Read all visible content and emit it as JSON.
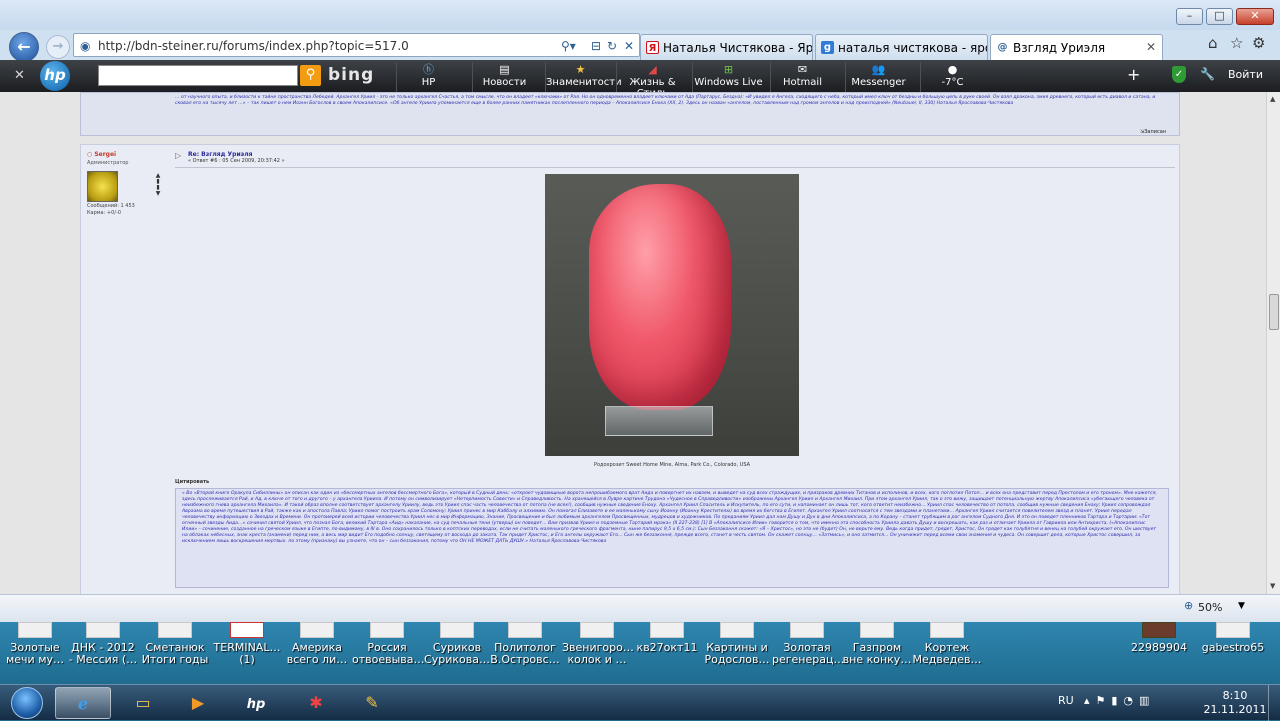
{
  "browser": {
    "url": "http://bdn-steiner.ru/forums/index.php?topic=517.0",
    "tabs": [
      {
        "label": "Наталья Чистякова - Ярос…",
        "icon": "Я"
      },
      {
        "label": "наталья чистякова - яросл…",
        "icon": "g"
      },
      {
        "label": "Взгляд Уриэля",
        "icon": "@"
      }
    ],
    "zoom": "50%",
    "window_buttons": {
      "minimize": "–",
      "maximize": "□",
      "close": "✕"
    }
  },
  "hp_toolbar": {
    "bing": "bing",
    "items": [
      {
        "label": "HP",
        "icon": "hp"
      },
      {
        "label": "Новости",
        "icon": "news"
      },
      {
        "label": "Знаменитости",
        "icon": "star"
      },
      {
        "label": "Жизнь & Стиль",
        "icon": "shoe"
      },
      {
        "label": "Windows Live",
        "icon": "windows"
      },
      {
        "label": "Hotmail",
        "icon": "mail"
      },
      {
        "label": "Messenger",
        "icon": "people"
      },
      {
        "label": "-7°C",
        "icon": "weather"
      }
    ],
    "login": "Войти"
  },
  "forum": {
    "prev_post_text": "… от научного опыта, и близости к тайне пространства Лебедей. Архангел Уриил - это не только архангел Счастья, а том смысле, что он владеет «ключами» от Рая. Но он одновременно владеет ключами от Ада (Партарус, Бездна): «И увидел я Ангела, сходящего с неба, который имел ключ от бездны и большую цепь в руке своей. Он взял дракона, змия древнего, который есть диавол и сатана, и сковал его на тысячу лет …» – так пишет о нем Иоанн Богослов в своем Апокалипсисе. «Об ангеле Уриила упоминается еще в более ранних памятниках послепленного периода – Апокалипсисе Еноха (XX, 2). Здесь он назван «ангелом, поставленным над громом ангелов и над преисподней» (Neubauer, II, 330) Наталья Ярославова-Чистякова",
    "edit_label": "Записан",
    "author": {
      "name": "Sergei",
      "role": "Администратор",
      "messages": "Сообщений: 1 453",
      "karma": "Карма: +0/-0"
    },
    "post": {
      "subject": "Re: Взгляд Уриэля",
      "reply": "« Ответ #6 : 05 Сен 2009, 20:37:42 »",
      "caption": "Родохрозит Sweet Home Mine, Alma, Park Co., Colorado, USA",
      "quote_label": "Цитировать",
      "quote_text": "« Во «Второй книге Оракула Сибиллины» он описан как один из «бессмертных ангелов бессмертного Бога», который в Судный день: «откроет чудовищные ворота непрошибаемого врат Аида и повергнет их навзем, и выведет на суд всех страждущих, и призраков древних Титанов и исполинов, и всех, кого поглотил Потоп… и всех она представит перед Престолом и его троном». Мне кажется, здесь прослеживается Рай, и Ад, в ключе от того и другого – у архангела Уриила. И потому он символизирует «Нетерпимость Совести» и Справедливость. На хранящейся в Лувре картине Трудона «Чудесное в Справедливости» изображены Архангел Уриил и Архангел Михаил. При этом архангел Уриил, так о это вижу, защищает потенциальную жертву Апокалипсиса «убегающего человека от неизбежного гнева архангела Михаила». И такой образ вполне соответствует архангелу Уриилу, ведь это Уриил спас часть человечества от потопа (не всех!), сообщив нужные сведения Еноху. Архангел Уриил Спаситель и Искупитель, по его сути, и напоминает он лишь тот, кого ответит неизбежно… Уриил спас человечество от потопа, сообщив нужные сведения Еноху; Уриил сопровождал Авраама во время путешествия в Рай, также как и апостола Павла; Уриил помог построить храм Соломону; Уриил принес в мир Каббалу и алхимию. Он помогал Елизавете и ее маленькому сыну Иоанну (Иоанну Крестителю) во время их бегства в Египет. Архангел Уриил соотносится с тем звездами и планетами… Архангел Уриил считается повелителем звезд и планет. Уриил передал человечеству информацию о Звездах и Времени. Он протоиерей всей истории человечества Уриил нес в мир Информацию, Знание, Просвещение и был любимым архангелом Просвещенных, мудрецов и художников. По преданиям Уриил дал нам Душу и Дух в дни Апокалипсиса, а по Корану – станет трубящим в рог ангелом Судного Дня. И это он поведет пленников Тартара и Тартарии: «Тот огненный звезды Аида…» сочинил святой Уриил, что познал Бога, великий Тартара «Аид» наказание, на суд печальные тени (утверш) он поведет… Вам призвав Уриил и подземные Тартарий мрака» (II 227-238) [1] В «Апокалипсисе Илии» говорится о том, что именно эта способность Уриила давать Душу и воскрешать, как раз и отличает Уриила от Гавриила или Антихриста, («Апокалипсис Илии» – сочинение, созданное на греческом языке в Египте, по-видимому, в III в. Оно сохранилось только в коптских переводах, если не считать маленького греческого фрагмента, ныне папирус 9,5 x 6,5 см.): Сын Беззаконня скажет: «Я – Христос», но это не (будет) Он, не верьте ему. Ведь когда придет, грядет, Христос, Он грядет как голубятня и венец на голубей окружает его. Он шествует на облаках небесных, знак креста (знамени) перед ним, а весь мир видит Его подобно солнцу, светящему от восхода до заката. Так придет Христос, и Его ангелы окружают Его… Сын же беззаконня, прежде всего, станет в честь святом. Он скажет солнцу… «Затмись», и оно затмится… Он уничижит перед всеми свои знамения и чудеса. Он совершит дела, которые Христос совершил, за исключением лишь воскрешения мертвых. по этому (признаку) вы узнаете, что он – сын беззакония, потому что ОН НЕ МОЖЕТ ДАТЬ ДУШУ.» Наталья Ярославова-Чистякова"
    }
  },
  "desktop_icons": [
    {
      "label": "Золотые мечи  му…"
    },
    {
      "label": "ДНК - 2012 - Мессия (…"
    },
    {
      "label": "Сметанюк Итоги годы"
    },
    {
      "label": "TERMINAL… (1)"
    },
    {
      "label": "Америка всего ли…"
    },
    {
      "label": "Россия отвоевыва…"
    },
    {
      "label": "Суриков Сурикова…"
    },
    {
      "label": "Политолог В.Островс…"
    },
    {
      "label": "Звенигоро… колок и …"
    },
    {
      "label": "кв27окт11"
    },
    {
      "label": "Картины и Родослов…"
    },
    {
      "label": "Золотая регенерац…"
    },
    {
      "label": "Газпром вне конку…"
    },
    {
      "label": "Кортеж Медведев…"
    },
    {
      "label": "22989904"
    },
    {
      "label": "gabestro65"
    }
  ],
  "taskbar": {
    "lang": "RU",
    "time": "8:10",
    "date": "21.11.2011"
  }
}
